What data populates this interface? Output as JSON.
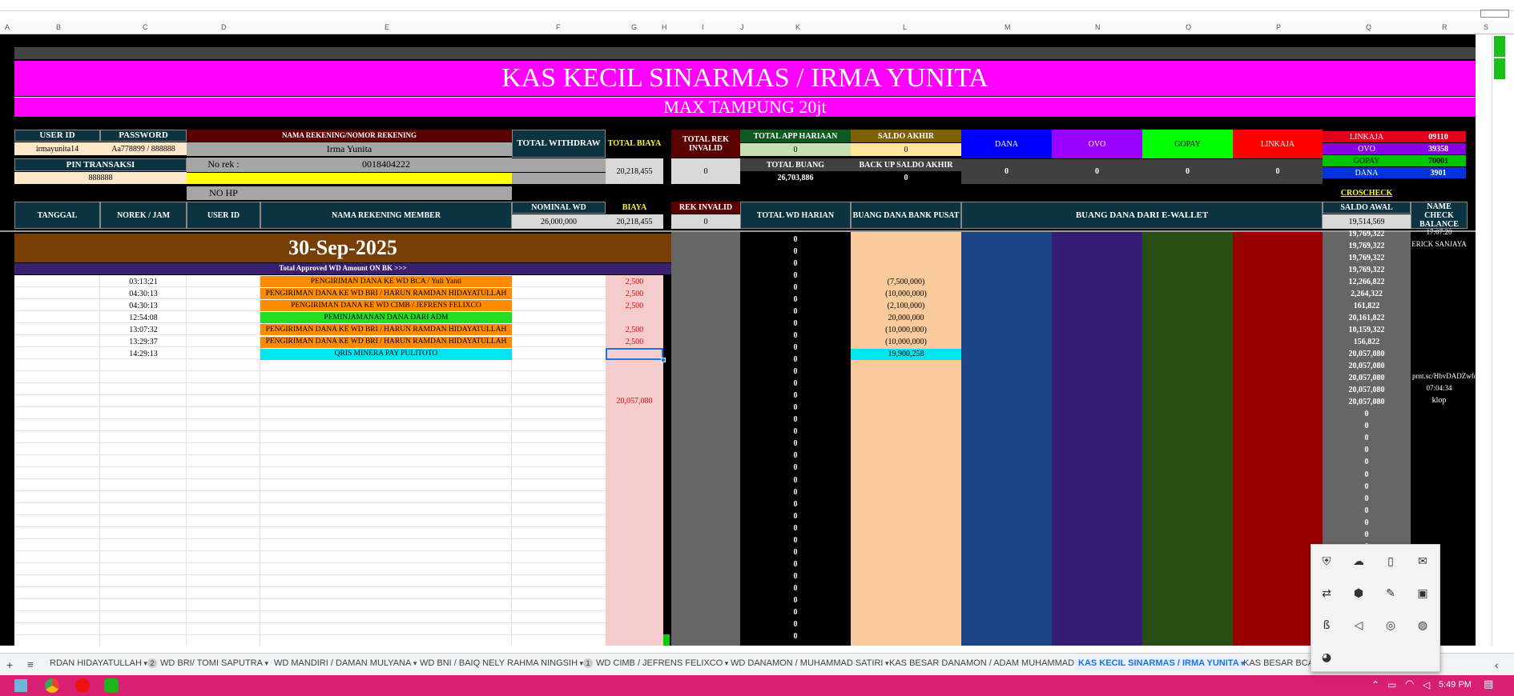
{
  "columns": [
    "A",
    "B",
    "C",
    "D",
    "E",
    "F",
    "G",
    "H",
    "I",
    "J",
    "K",
    "L",
    "M",
    "N",
    "O",
    "P",
    "Q",
    "R",
    "S"
  ],
  "banner": {
    "title": "KAS KECIL SINARMAS / IRMA YUNITA",
    "subtitle": "MAX TAMPUNG 20jt"
  },
  "info": {
    "user_id_label": "USER ID",
    "password_label": "PASSWORD",
    "user_id": "irmayunita14",
    "password": "Aa778899 / 888888",
    "pin_label": "PIN TRANSAKSI",
    "pin": "888888",
    "rekening_label": "NAMA REKENING/NOMOR REKENING",
    "rekening_name": "Irma Yunita",
    "norek_label": "No rek :",
    "norek": "0018404222",
    "nohp_label": "NO HP",
    "total_withdraw_label": "TOTAL WITHDRAW",
    "total_biaya_label": "TOTAL BIAYA",
    "total_biaya": "20,218,455",
    "total_rek_invalid_label": "TOTAL REK INVALID",
    "total_rek_invalid": "0",
    "total_app_label": "TOTAL APP HARIAAN",
    "total_app": "0",
    "saldo_akhir_label": "SALDO AKHIR",
    "saldo_akhir": "0",
    "total_buang_label": "TOTAL BUANG",
    "total_buang": "26,703,886",
    "backup_label": "BACK UP SALDO AKHIR",
    "backup": "0",
    "dana_label": "DANA",
    "ovo_label": "OVO",
    "gopay_label": "GOPAY",
    "linkaja_label": "LINKAJA",
    "dana_val": "0",
    "ovo_val": "0",
    "gopay_val": "0",
    "linkaja_val": "0",
    "ewallet_side": [
      {
        "name": "LINKAJA",
        "code": "09110",
        "color": "#e0001b"
      },
      {
        "name": "OVO",
        "code": "39358",
        "color": "#8a00e6"
      },
      {
        "name": "GOPAY",
        "code": "70001",
        "color": "#00c400"
      },
      {
        "name": "DANA",
        "code": "3901",
        "color": "#0033dd"
      }
    ],
    "croscheck": "CROSCHECK"
  },
  "headers": {
    "tanggal": "TANGGAL",
    "norek_jam": "NOREK / JAM",
    "user_id": "USER ID",
    "nama_member": "NAMA REKENING MEMBER",
    "nominal_wd": "NOMINAL WD",
    "nominal_wd_val": "26,000,000",
    "biaya": "BIAYA",
    "biaya_val": "20,218,455",
    "rek_invalid": "REK INVALID",
    "rek_invalid_val": "0",
    "total_wd_harian": "TOTAL WD HARIAN",
    "buang_dana_bank": "BUANG DANA BANK PUSAT",
    "buang_dana_ewallet": "BUANG DANA DARI E-WALLET",
    "saldo_awal": "SALDO AWAL",
    "saldo_awal_val": "19,514,569",
    "name_check": "NAME CHECK BALANCE"
  },
  "date_banner": "30-Sep-2025",
  "approved_label": "Total Approved WD Amount ON BK >>>",
  "transactions": [
    {
      "time": "03:13:21",
      "desc": "PENGIRIMAN DANA KE WD BCA / Yuli Yanti",
      "biaya": "2,500",
      "buang": "(7,500,000)",
      "color": "#ff8c00"
    },
    {
      "time": "04:30:13",
      "desc": "PENGIRIMAN DANA KE WD BRI / HARUN RAMDAN HIDAYATULLAH",
      "biaya": "2,500",
      "buang": "(10,000,000)",
      "color": "#ff8c00"
    },
    {
      "time": "04:30:13",
      "desc": "PENGIRIMAN DANA KE WD CIMB / JEFRENS FELIXCO",
      "biaya": "2,500",
      "buang": "(2,100,000)",
      "color": "#ff8c00"
    },
    {
      "time": "12:54:08",
      "desc": "PEMINJAMANAN DANA DARI ADM",
      "biaya": "",
      "buang": "20,000,000",
      "color": "#22dd22"
    },
    {
      "time": "13:07:32",
      "desc": "PENGIRIMAN DANA KE WD BRI / HARUN RAMDAN HIDAYATULLAH",
      "biaya": "2,500",
      "buang": "(10,000,000)",
      "color": "#ff8c00"
    },
    {
      "time": "13:29:37",
      "desc": "PENGIRIMAN DANA KE WD BRI / HARUN RAMDAN HIDAYATULLAH",
      "biaya": "2,500",
      "buang": "(10,000,000)",
      "color": "#ff8c00"
    },
    {
      "time": "14:29:13",
      "desc": "QRIS MINERA PAY PULITOTO",
      "biaya": "",
      "buang": "19,900,258",
      "color": "#00e5ee"
    }
  ],
  "biaya_total": "20,057,080",
  "saldo_column": [
    "19,769,322",
    "19,769,322",
    "19,769,322",
    "19,769,322",
    "12,266,822",
    "2,264,322",
    "161,822",
    "20,161,822",
    "10,159,322",
    "156,822",
    "20,057,080",
    "20,057,080",
    "20,057,080",
    "20,057,080",
    "20,057,080",
    "0",
    "0",
    "0",
    "0",
    "0",
    "0",
    "0",
    "0",
    "0",
    "0",
    "0",
    "0",
    "0",
    "0",
    "0"
  ],
  "name_check_entries": {
    "time1": "17:07:20",
    "name": "ERICK SANJAYA",
    "link": "prnt.sc/HbvDADZwfdAZ",
    "time2": "07:04:34",
    "note": "klop"
  },
  "zero": "0",
  "tabs": [
    {
      "label": "RDAN HIDAYATULLAH"
    },
    {
      "label": "WD BRI/ TOMI SAPUTRA",
      "badge": "2"
    },
    {
      "label": "WD MANDIRI / DAMAN MULYANA"
    },
    {
      "label": "WD BNI / BAIQ NELY RAHMA NINGSIH"
    },
    {
      "label": "WD CIMB / JEFRENS FELIXCO",
      "badge": "1"
    },
    {
      "label": "WD DANAMON / MUHAMMAD SATIRI"
    },
    {
      "label": "KAS BESAR DANAMON / ADAM MUHAMMAD"
    },
    {
      "label": "KAS KECIL SINARMAS / IRMA YUNITA",
      "active": true
    },
    {
      "label": "KAS BESAR BCA /"
    }
  ],
  "clock": "5:49 PM",
  "tray_icons": [
    "shield-icon",
    "cloud-off-icon",
    "usb-icon",
    "chat-icon",
    "network-icon",
    "vpn-icon",
    "pen-icon",
    "camera-icon",
    "bitdefender-icon",
    "volume-icon",
    "wifi-icon",
    "globe-icon",
    "discord-icon"
  ]
}
